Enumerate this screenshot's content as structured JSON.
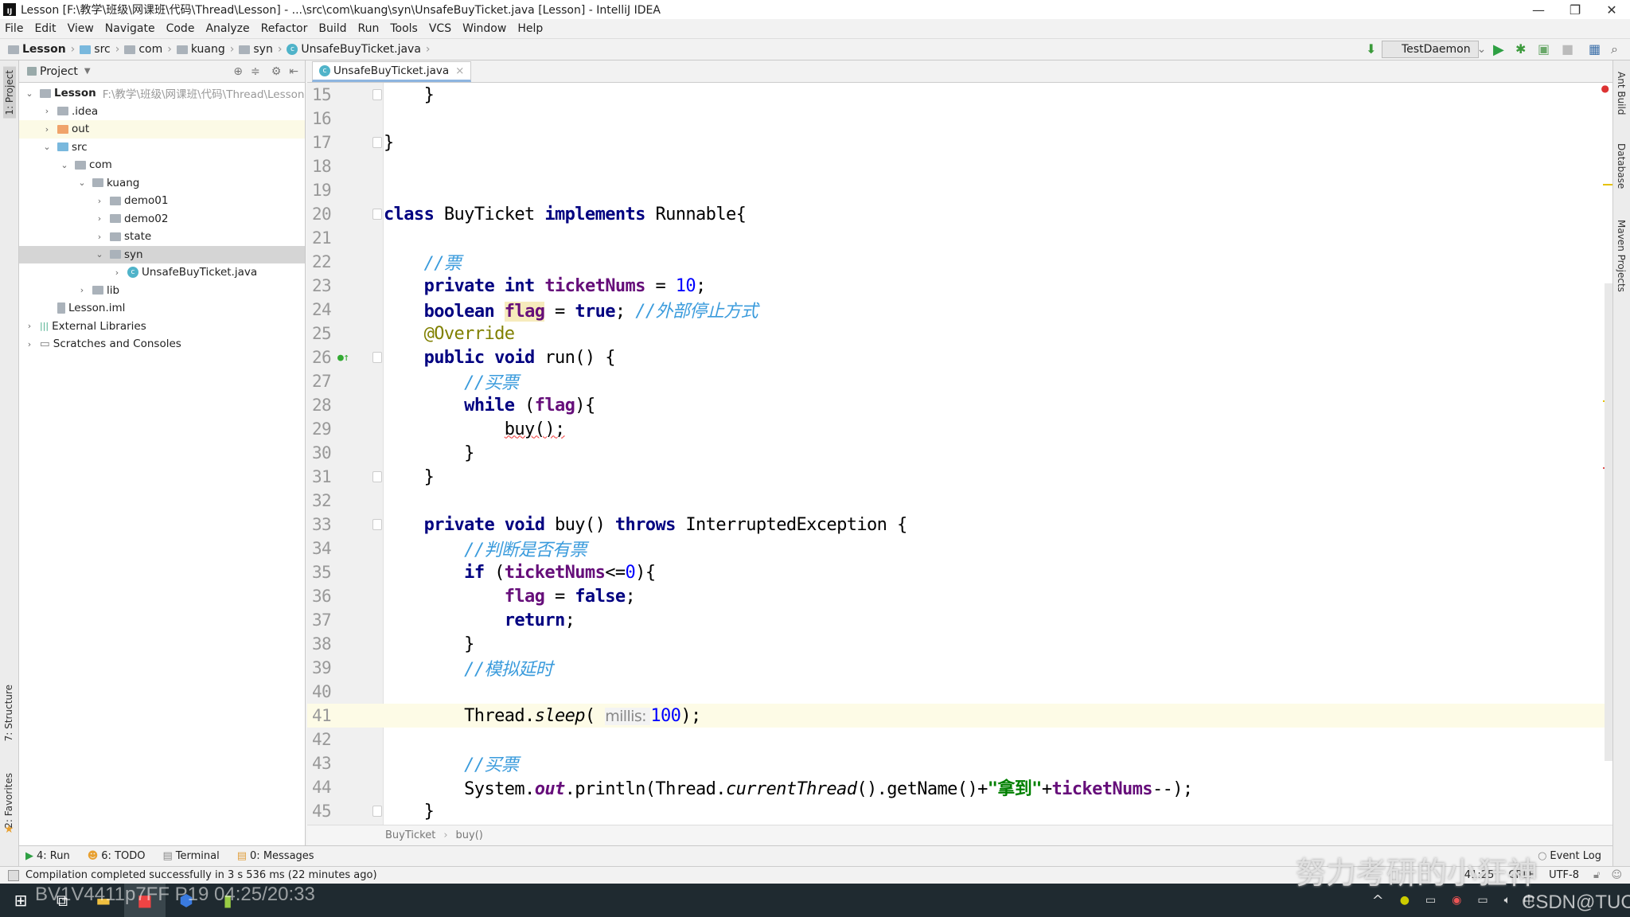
{
  "window": {
    "title": "Lesson [F:\\教学\\班级\\网课班\\代码\\Thread\\Lesson] - ...\\src\\com\\kuang\\syn\\UnsafeBuyTicket.java [Lesson] - IntelliJ IDEA",
    "minimize": "—",
    "maximize": "❐",
    "close": "✕"
  },
  "menu": [
    "File",
    "Edit",
    "View",
    "Navigate",
    "Code",
    "Analyze",
    "Refactor",
    "Build",
    "Run",
    "Tools",
    "VCS",
    "Window",
    "Help"
  ],
  "breadcrumb": [
    "Lesson",
    "src",
    "com",
    "kuang",
    "syn",
    "UnsafeBuyTicket.java"
  ],
  "run_config": "TestDaemon",
  "left_strip": {
    "project": "1: Project",
    "structure": "7: Structure",
    "favorites": "2: Favorites"
  },
  "right_strip": [
    "Ant Build",
    "Database",
    "Maven Projects"
  ],
  "project": {
    "title": "Project",
    "tree": [
      {
        "label": "Lesson",
        "path": "F:\\教学\\班级\\网课班\\代码\\Thread\\Lesson",
        "depth": 0,
        "arrow": "⌄",
        "icon": "module"
      },
      {
        "label": ".idea",
        "depth": 1,
        "arrow": "›",
        "icon": "folder"
      },
      {
        "label": "out",
        "depth": 1,
        "arrow": "›",
        "icon": "folder-orange",
        "highlight": true
      },
      {
        "label": "src",
        "depth": 1,
        "arrow": "⌄",
        "icon": "folder-blue"
      },
      {
        "label": "com",
        "depth": 2,
        "arrow": "⌄",
        "icon": "folder"
      },
      {
        "label": "kuang",
        "depth": 3,
        "arrow": "⌄",
        "icon": "folder"
      },
      {
        "label": "demo01",
        "depth": 4,
        "arrow": "›",
        "icon": "folder"
      },
      {
        "label": "demo02",
        "depth": 4,
        "arrow": "›",
        "icon": "folder"
      },
      {
        "label": "state",
        "depth": 4,
        "arrow": "›",
        "icon": "folder"
      },
      {
        "label": "syn",
        "depth": 4,
        "arrow": "⌄",
        "icon": "folder",
        "selected": true
      },
      {
        "label": "UnsafeBuyTicket.java",
        "depth": 5,
        "arrow": "›",
        "icon": "java-class"
      },
      {
        "label": "lib",
        "depth": 3,
        "arrow": "›",
        "icon": "folder"
      },
      {
        "label": "Lesson.iml",
        "depth": 1,
        "arrow": "",
        "icon": "file"
      },
      {
        "label": "External Libraries",
        "depth": 0,
        "arrow": "›",
        "icon": "library"
      },
      {
        "label": "Scratches and Consoles",
        "depth": 0,
        "arrow": "›",
        "icon": "scratch"
      }
    ]
  },
  "editor": {
    "tab": "UnsafeBuyTicket.java",
    "current_line": 41,
    "lines": [
      {
        "n": "15",
        "t": [
          [
            "    }",
            ""
          ]
        ]
      },
      {
        "n": "16",
        "t": []
      },
      {
        "n": "17",
        "t": [
          [
            "}",
            ""
          ]
        ]
      },
      {
        "n": "18",
        "t": []
      },
      {
        "n": "19",
        "t": []
      },
      {
        "n": "20",
        "t": [
          [
            "class",
            "kw"
          ],
          [
            " BuyTicket ",
            ""
          ],
          [
            "implements",
            "kw"
          ],
          [
            " Runnable{",
            ""
          ]
        ]
      },
      {
        "n": "21",
        "t": []
      },
      {
        "n": "22",
        "t": [
          [
            "    ",
            ""
          ],
          [
            "//票",
            "cmt"
          ]
        ]
      },
      {
        "n": "23",
        "t": [
          [
            "    ",
            ""
          ],
          [
            "private int",
            "kw"
          ],
          [
            " ",
            ""
          ],
          [
            "ticketNums",
            "fld"
          ],
          [
            " = ",
            ""
          ],
          [
            "10",
            "num"
          ],
          [
            ";",
            ""
          ]
        ]
      },
      {
        "n": "24",
        "t": [
          [
            "    ",
            ""
          ],
          [
            "boolean",
            "kw"
          ],
          [
            " ",
            ""
          ],
          [
            "flag",
            "fld hlbg"
          ],
          [
            " = ",
            ""
          ],
          [
            "true",
            "kw"
          ],
          [
            "; ",
            ""
          ],
          [
            "//外部停止方式",
            "cmt"
          ]
        ]
      },
      {
        "n": "25",
        "t": [
          [
            "    ",
            ""
          ],
          [
            "@Override",
            "ann"
          ]
        ]
      },
      {
        "n": "26",
        "t": [
          [
            "    ",
            ""
          ],
          [
            "public void",
            "kw"
          ],
          [
            " run() {",
            ""
          ]
        ]
      },
      {
        "n": "27",
        "t": [
          [
            "        ",
            ""
          ],
          [
            "//买票",
            "cmt"
          ]
        ]
      },
      {
        "n": "28",
        "t": [
          [
            "        ",
            ""
          ],
          [
            "while",
            "kw"
          ],
          [
            " (",
            ""
          ],
          [
            "flag",
            "fld"
          ],
          [
            "){",
            ""
          ]
        ]
      },
      {
        "n": "29",
        "t": [
          [
            "            ",
            ""
          ],
          [
            "buy();",
            "squig"
          ]
        ]
      },
      {
        "n": "30",
        "t": [
          [
            "        }",
            ""
          ]
        ]
      },
      {
        "n": "31",
        "t": [
          [
            "    }",
            ""
          ]
        ]
      },
      {
        "n": "32",
        "t": []
      },
      {
        "n": "33",
        "t": [
          [
            "    ",
            ""
          ],
          [
            "private void",
            "kw"
          ],
          [
            " buy() ",
            ""
          ],
          [
            "throws",
            "kw"
          ],
          [
            " InterruptedException {",
            ""
          ]
        ]
      },
      {
        "n": "34",
        "t": [
          [
            "        ",
            ""
          ],
          [
            "//判断是否有票",
            "cmt"
          ]
        ]
      },
      {
        "n": "35",
        "t": [
          [
            "        ",
            ""
          ],
          [
            "if",
            "kw"
          ],
          [
            " (",
            ""
          ],
          [
            "ticketNums",
            "fld"
          ],
          [
            "<=",
            ""
          ],
          [
            "0",
            "num"
          ],
          [
            "){",
            ""
          ]
        ]
      },
      {
        "n": "36",
        "t": [
          [
            "            ",
            ""
          ],
          [
            "flag",
            "fld"
          ],
          [
            " = ",
            ""
          ],
          [
            "false",
            "kw"
          ],
          [
            ";",
            ""
          ]
        ]
      },
      {
        "n": "37",
        "t": [
          [
            "            ",
            ""
          ],
          [
            "return",
            "kw"
          ],
          [
            ";",
            ""
          ]
        ]
      },
      {
        "n": "38",
        "t": [
          [
            "        }",
            ""
          ]
        ]
      },
      {
        "n": "39",
        "t": [
          [
            "        ",
            ""
          ],
          [
            "//模拟延时",
            "cmt"
          ]
        ]
      },
      {
        "n": "40",
        "t": []
      },
      {
        "n": "41",
        "t": [
          [
            "        Thread.",
            ""
          ],
          [
            "sleep",
            "it"
          ],
          [
            "( ",
            ""
          ],
          [
            "millis: ",
            "hint"
          ],
          [
            "100",
            "num"
          ],
          [
            ");",
            ""
          ]
        ]
      },
      {
        "n": "42",
        "t": []
      },
      {
        "n": "43",
        "t": [
          [
            "        ",
            ""
          ],
          [
            "//买票",
            "cmt"
          ]
        ]
      },
      {
        "n": "44",
        "t": [
          [
            "        System.",
            ""
          ],
          [
            "out",
            "st"
          ],
          [
            ".println(Thread.",
            ""
          ],
          [
            "currentThread",
            "it"
          ],
          [
            "().getName()+",
            ""
          ],
          [
            "\"拿到\"",
            "str"
          ],
          [
            "+",
            ""
          ],
          [
            "ticketNums",
            "fld"
          ],
          [
            "--);",
            ""
          ]
        ]
      },
      {
        "n": "45",
        "t": [
          [
            "    }",
            ""
          ]
        ]
      }
    ],
    "breadcrumb": [
      "BuyTicket",
      "buy()"
    ]
  },
  "tool_windows": [
    "4: Run",
    "6: TODO",
    "Terminal",
    "0: Messages"
  ],
  "event_log": "Event Log",
  "status": {
    "message": "Compilation completed successfully in 3 s 536 ms (22 minutes ago)",
    "position": "41:25",
    "line_sep": "CRLF",
    "encoding": "UTF-8"
  },
  "overlays": {
    "video": "BV1V4411p7FF P19 04:25/20:33",
    "channel": "努力考研的小狂神",
    "csdn": "CSDN@TUC"
  },
  "tray": {
    "ime": "中"
  }
}
